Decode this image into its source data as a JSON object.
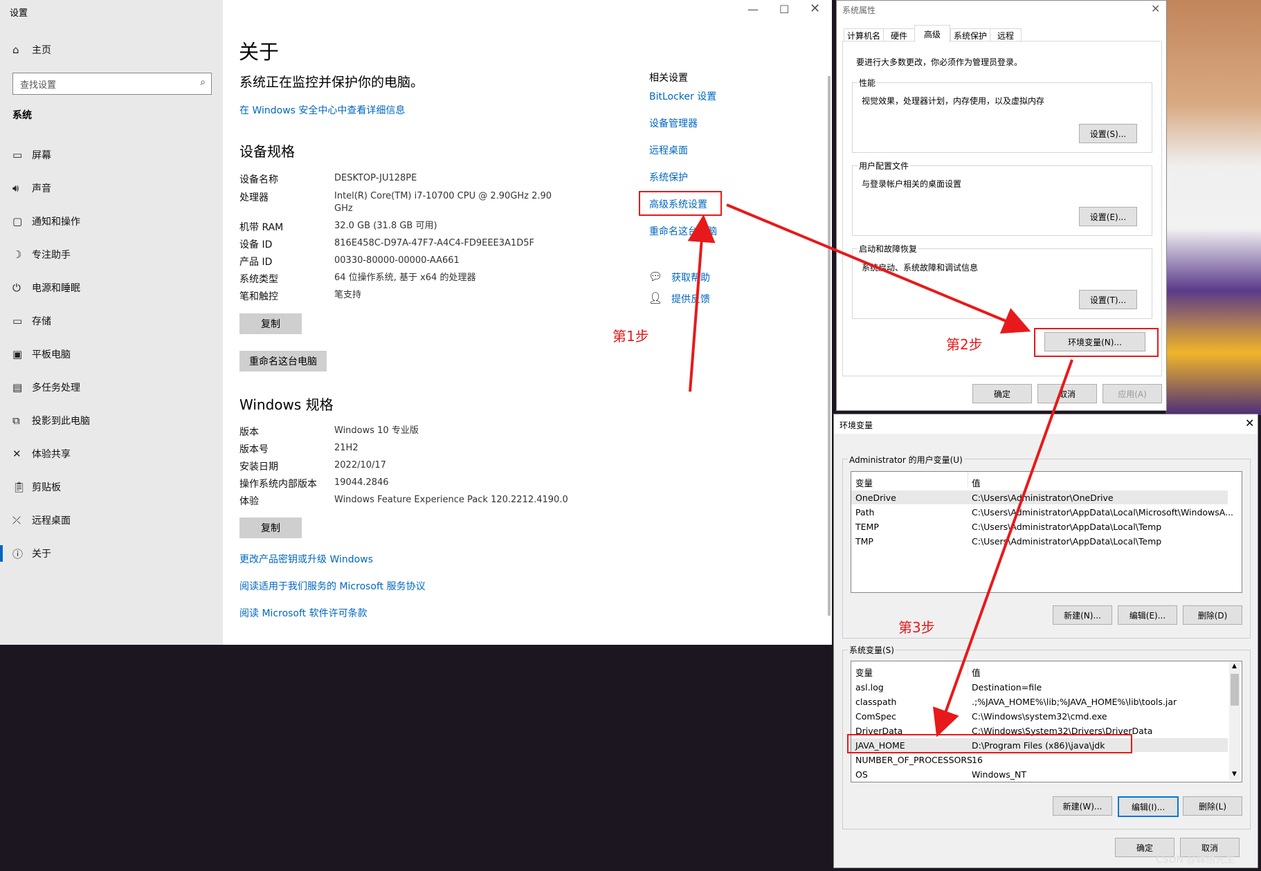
{
  "settings": {
    "window_title": "设置",
    "sidebar": {
      "home": "主页",
      "search_placeholder": "查找设置",
      "section": "系统",
      "items": [
        "屏幕",
        "声音",
        "通知和操作",
        "专注助手",
        "电源和睡眠",
        "存储",
        "平板电脑",
        "多任务处理",
        "投影到此电脑",
        "体验共享",
        "剪贴板",
        "远程桌面",
        "关于"
      ]
    },
    "page_title": "关于",
    "protect_text": "系统正在监控并保护你的电脑。",
    "security_link": "在 Windows 安全中心中查看详细信息",
    "device_specs": {
      "title": "设备规格",
      "rows": [
        {
          "k": "设备名称",
          "v": "DESKTOP-JU128PE"
        },
        {
          "k": "处理器",
          "v": "Intel(R) Core(TM) i7-10700 CPU @ 2.90GHz   2.90 GHz"
        },
        {
          "k": "机带 RAM",
          "v": "32.0 GB (31.8 GB 可用)"
        },
        {
          "k": "设备 ID",
          "v": "816E458C-D97A-47F7-A4C4-FD9EEE3A1D5F"
        },
        {
          "k": "产品 ID",
          "v": "00330-80000-00000-AA661"
        },
        {
          "k": "系统类型",
          "v": "64 位操作系统, 基于 x64 的处理器"
        },
        {
          "k": "笔和触控",
          "v": "笔支持"
        }
      ],
      "copy": "复制",
      "rename": "重命名这台电脑"
    },
    "windows_specs": {
      "title": "Windows 规格",
      "rows": [
        {
          "k": "版本",
          "v": "Windows 10 专业版"
        },
        {
          "k": "版本号",
          "v": "21H2"
        },
        {
          "k": "安装日期",
          "v": "2022/10/17"
        },
        {
          "k": "操作系统内部版本",
          "v": "19044.2846"
        },
        {
          "k": "体验",
          "v": "Windows Feature Experience Pack 120.2212.4190.0"
        }
      ],
      "copy": "复制"
    },
    "bottom_links": [
      "更改产品密钥或升级 Windows",
      "阅读适用于我们服务的 Microsoft 服务协议",
      "阅读 Microsoft 软件许可条款"
    ],
    "related": {
      "title": "相关设置",
      "links": [
        "BitLocker 设置",
        "设备管理器",
        "远程桌面",
        "系统保护",
        "高级系统设置",
        "重命名这台电脑"
      ],
      "help": "获取帮助",
      "feedback": "提供反馈"
    }
  },
  "sysprops": {
    "title": "系统属性",
    "tabs": [
      "计算机名",
      "硬件",
      "高级",
      "系统保护",
      "远程"
    ],
    "admin_note": "要进行大多数更改，你必须作为管理员登录。",
    "perf": {
      "label": "性能",
      "desc": "视觉效果，处理器计划，内存使用，以及虚拟内存",
      "btn": "设置(S)..."
    },
    "profile": {
      "label": "用户配置文件",
      "desc": "与登录帐户相关的桌面设置",
      "btn": "设置(E)..."
    },
    "startup": {
      "label": "启动和故障恢复",
      "desc": "系统启动、系统故障和调试信息",
      "btn": "设置(T)..."
    },
    "env_btn": "环境变量(N)...",
    "ok": "确定",
    "cancel": "取消",
    "apply": "应用(A)"
  },
  "envvars": {
    "title": "环境变量",
    "user_label": "Administrator 的用户变量(U)",
    "col_var": "变量",
    "col_val": "值",
    "user_rows": [
      {
        "k": "OneDrive",
        "v": "C:\\Users\\Administrator\\OneDrive"
      },
      {
        "k": "Path",
        "v": "C:\\Users\\Administrator\\AppData\\Local\\Microsoft\\WindowsA..."
      },
      {
        "k": "TEMP",
        "v": "C:\\Users\\Administrator\\AppData\\Local\\Temp"
      },
      {
        "k": "TMP",
        "v": "C:\\Users\\Administrator\\AppData\\Local\\Temp"
      }
    ],
    "user_btns": [
      "新建(N)...",
      "编辑(E)...",
      "删除(D)"
    ],
    "sys_label": "系统变量(S)",
    "sys_rows": [
      {
        "k": "asl.log",
        "v": "Destination=file"
      },
      {
        "k": "classpath",
        "v": ".;%JAVA_HOME%\\lib;%JAVA_HOME%\\lib\\tools.jar"
      },
      {
        "k": "ComSpec",
        "v": "C:\\Windows\\system32\\cmd.exe"
      },
      {
        "k": "DriverData",
        "v": "C:\\Windows\\System32\\Drivers\\DriverData"
      },
      {
        "k": "JAVA_HOME",
        "v": "D:\\Program Files (x86)\\java\\jdk"
      },
      {
        "k": "NUMBER_OF_PROCESSORS",
        "v": "16"
      },
      {
        "k": "OS",
        "v": "Windows_NT"
      }
    ],
    "sys_btns": [
      "新建(W)...",
      "编辑(I)...",
      "删除(L)"
    ],
    "ok": "确定",
    "cancel": "取消"
  },
  "annotations": {
    "step1": "第1步",
    "step2": "第2步",
    "step3": "第3步"
  },
  "watermark": "CSDN @肆悟先生",
  "colors": {
    "annotation_red": "#e8191a",
    "link_blue": "#0067c0"
  }
}
